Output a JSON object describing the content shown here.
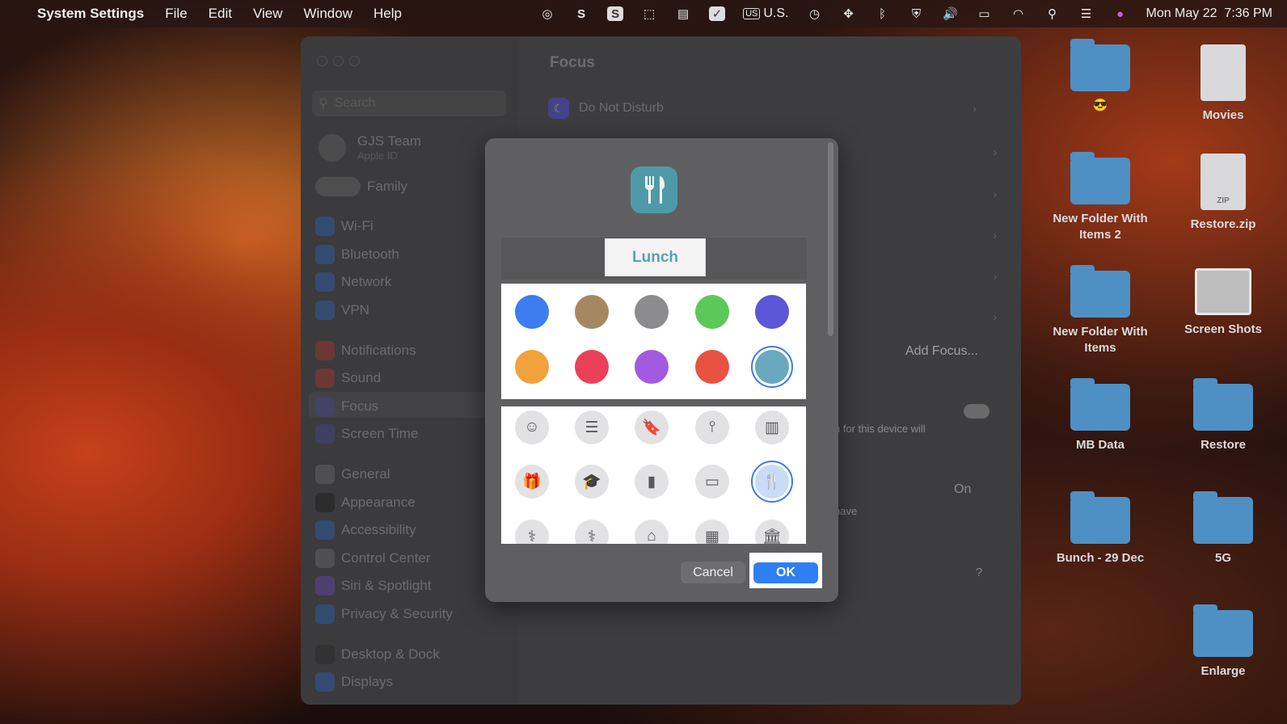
{
  "menubar": {
    "apple_icon": "apple-icon",
    "app_name": "System Settings",
    "menus": [
      "File",
      "Edit",
      "View",
      "Window",
      "Help"
    ],
    "input_source": "U.S.",
    "datetime": "Mon May 22  7:36 PM"
  },
  "sidebar": {
    "search_placeholder": "Search",
    "user_name": "GJS Team",
    "user_sub": "Apple ID",
    "family": "Family",
    "items": [
      "Wi-Fi",
      "Bluetooth",
      "Network",
      "VPN",
      "Notifications",
      "Sound",
      "Focus",
      "Screen Time",
      "General",
      "Appearance",
      "Accessibility",
      "Control Center",
      "Siri & Spotlight",
      "Privacy & Security",
      "Desktop & Dock",
      "Displays"
    ],
    "selected": "Focus"
  },
  "main": {
    "title": "Focus",
    "first_row": "Do Not Disturb",
    "add_focus": "Add Focus...",
    "text1": "n for this device will",
    "on_label": "On",
    "text2": "have",
    "help": "?"
  },
  "dialog": {
    "focus_name": "Lunch",
    "selected_color": "#6aa8bd",
    "colors": [
      "#3d7df0",
      "#a58862",
      "#8c8c8e",
      "#5cc85a",
      "#5a57d8",
      "#f2a23c",
      "#ea4058",
      "#a35ae0",
      "#e85240",
      "#6aa8bd"
    ],
    "icons": [
      "smiley-icon",
      "list-icon",
      "bookmark-icon",
      "pin-icon",
      "books-icon",
      "gift-icon",
      "graduation-cap-icon",
      "document-icon",
      "credit-card-icon",
      "fork-knife-icon",
      "pills-icon",
      "stethoscope-icon",
      "house-icon",
      "building-icon",
      "bank-icon"
    ],
    "selected_icon": "fork-knife-icon",
    "cancel_label": "Cancel",
    "ok_label": "OK"
  },
  "desktop": [
    {
      "label": "😎",
      "kind": "folder"
    },
    {
      "label": "Movies",
      "kind": "file"
    },
    {
      "label": "New Folder With Items 2",
      "kind": "folder"
    },
    {
      "label": "Restore.zip",
      "kind": "zip"
    },
    {
      "label": "New Folder With Items",
      "kind": "folder"
    },
    {
      "label": "Screen Shots",
      "kind": "shot"
    },
    {
      "label": "MB Data",
      "kind": "folder"
    },
    {
      "label": "Restore",
      "kind": "folder"
    },
    {
      "label": "Bunch - 29 Dec",
      "kind": "folder"
    },
    {
      "label": "5G",
      "kind": "folder"
    },
    {
      "label": "Enlarge",
      "kind": "folder"
    }
  ],
  "zip_badge": "ZIP"
}
